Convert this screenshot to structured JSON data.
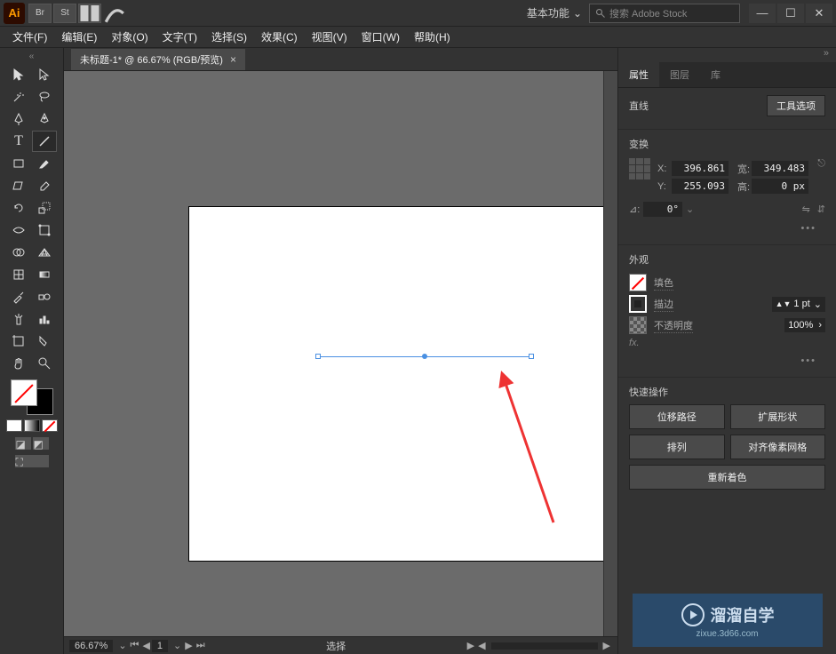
{
  "titlebar": {
    "logo": "Ai",
    "br": "Br",
    "st": "St",
    "workspace": "基本功能",
    "search_placeholder": "搜索 Adobe Stock"
  },
  "menu": {
    "file": "文件(F)",
    "edit": "编辑(E)",
    "object": "对象(O)",
    "type": "文字(T)",
    "select": "选择(S)",
    "effect": "效果(C)",
    "view": "视图(V)",
    "window": "窗口(W)",
    "help": "帮助(H)"
  },
  "doc": {
    "tab_title": "未标题-1* @ 66.67% (RGB/预览)"
  },
  "status": {
    "zoom": "66.67%",
    "page": "1",
    "mode": "选择"
  },
  "panels": {
    "props": "属性",
    "layers": "图层",
    "libs": "库"
  },
  "props": {
    "section_label_line": "直线",
    "tool_options": "工具选项",
    "transform": "变换",
    "x_lbl": "X:",
    "y_lbl": "Y:",
    "w_lbl": "宽:",
    "h_lbl": "高:",
    "x": "396.861",
    "y": "255.093",
    "w": "349.483",
    "h": "0 px",
    "angle_lbl": "⊿:",
    "angle": "0°",
    "appearance": "外观",
    "fill": "填色",
    "stroke": "描边",
    "opacity": "不透明度",
    "stroke_val": "1 pt",
    "opacity_val": "100%",
    "fx": "fx.",
    "quick_actions": "快速操作",
    "qa_offset": "位移路径",
    "qa_expand": "扩展形状",
    "qa_arrange": "排列",
    "qa_align": "对齐像素网格",
    "qa_recolor": "重新着色"
  },
  "watermark": {
    "title": "溜溜自学",
    "url": "zixue.3d66.com"
  }
}
